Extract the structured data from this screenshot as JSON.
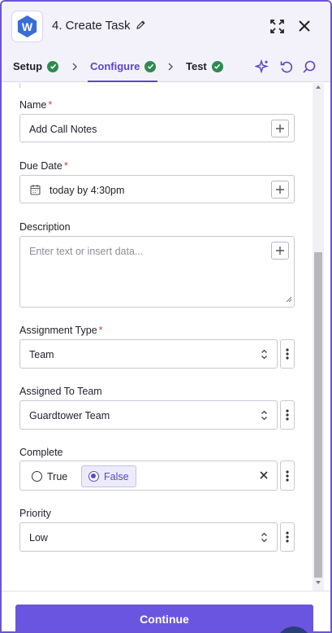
{
  "header": {
    "title": "4. Create Task",
    "logo_letter": "W",
    "icons": [
      "pencil-icon",
      "expand-icon",
      "close-icon"
    ]
  },
  "steps": [
    {
      "label": "Setup",
      "status": "complete"
    },
    {
      "label": "Configure",
      "status": "complete",
      "active": true
    },
    {
      "label": "Test",
      "status": "complete"
    }
  ],
  "toolbar_icons": [
    "sparkle-icon",
    "undo-icon",
    "search-icon"
  ],
  "form": {
    "name": {
      "label": "Name",
      "required_mark": "*",
      "value": "Add Call Notes"
    },
    "due_date": {
      "label": "Due Date",
      "required_mark": "*",
      "value": "today by 4:30pm"
    },
    "description": {
      "label": "Description",
      "placeholder": "Enter text or insert data..."
    },
    "assignment_type": {
      "label": "Assignment Type",
      "required_mark": "*",
      "value": "Team"
    },
    "assigned_to_team": {
      "label": "Assigned To Team",
      "value": "Guardtower Team"
    },
    "complete": {
      "label": "Complete",
      "options": [
        "True",
        "False"
      ],
      "selected": "False"
    },
    "priority": {
      "label": "Priority",
      "value": "Low"
    }
  },
  "footer": {
    "continue_label": "Continue"
  },
  "colors": {
    "accent": "#6a55e0",
    "check": "#2e8b4e",
    "required": "#d0483c"
  }
}
